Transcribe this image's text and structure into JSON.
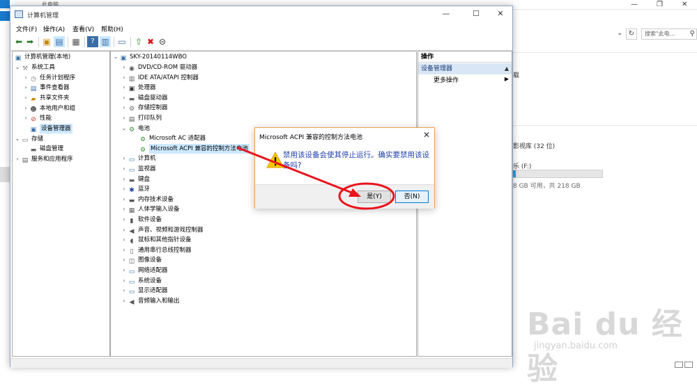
{
  "background": {
    "explorer_title": "此电脑",
    "search_placeholder": "搜索\"此电...",
    "drive_label_partial": "影视库 (32 位)",
    "drive_f_label": "乐 (F:)",
    "drive_f_usage": "8 GB 可用，共 218 GB",
    "drive_f_fill_fraction": 0.03,
    "letter_partial": "载"
  },
  "window": {
    "title": "计算机管理",
    "menus": [
      "文件(F)",
      "操作(A)",
      "查看(V)",
      "帮助(H)"
    ]
  },
  "left_tree": {
    "root": "计算机管理(本地)",
    "system_tools": "系统工具",
    "task_scheduler": "任务计划程序",
    "event_viewer": "事件查看器",
    "shared_folders": "共享文件夹",
    "local_users": "本地用户和组",
    "performance": "性能",
    "device_manager": "设备管理器",
    "storage": "存储",
    "disk_management": "磁盘管理",
    "services": "服务和应用程序"
  },
  "device_tree": {
    "computer": "SKY-20140114WBO",
    "items": [
      "DVD/CD-ROM 驱动器",
      "IDE ATA/ATAPI 控制器",
      "处理器",
      "磁盘驱动器",
      "存储控制器",
      "打印队列",
      "电池",
      "Microsoft AC 适配器",
      "Microsoft ACPI 兼容的控制方法电池",
      "计算机",
      "监视器",
      "键盘",
      "蓝牙",
      "内存技术设备",
      "人体学输入设备",
      "软件设备",
      "声音、视频和游戏控制器",
      "鼠标和其他指针设备",
      "通用串行总线控制器",
      "图像设备",
      "网络适配器",
      "系统设备",
      "显示适配器",
      "音频输入和输出"
    ]
  },
  "actions": {
    "header": "操作",
    "section": "设备管理器",
    "more": "更多操作"
  },
  "dialog": {
    "title": "Microsoft ACPI 兼容的控制方法电池",
    "message": "禁用该设备会使其停止运行。确实要禁用该设备吗?",
    "yes": "是(Y)",
    "no": "否(N)"
  },
  "watermark": {
    "brand": "Bai du 经验",
    "url": "jingyan.baidu.com"
  },
  "colors": {
    "annotation_red": "#e8141c",
    "selection": "#cce8ff",
    "dialog_border": "#f2a34a",
    "message_blue": "#1f3fa8"
  }
}
